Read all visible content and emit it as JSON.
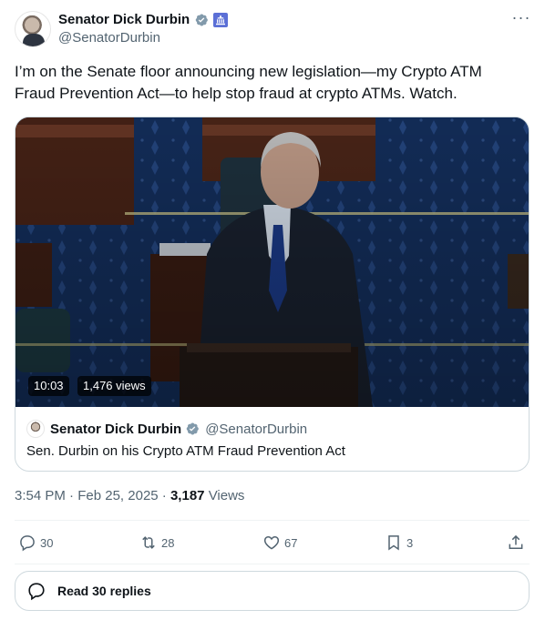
{
  "author": {
    "display_name": "Senator Dick Durbin",
    "handle": "@SenatorDurbin"
  },
  "tweet_text": "I’m on the Senate floor announcing new legislation—my Crypto ATM Fraud Prevention Act—to help stop fraud at crypto ATMs. Watch.",
  "video": {
    "duration": "10:03",
    "views": "1,476 views"
  },
  "quote": {
    "name": "Senator Dick Durbin",
    "handle": "@SenatorDurbin",
    "caption": "Sen. Durbin on his Crypto ATM Fraud Prevention Act"
  },
  "meta": {
    "time": "3:54 PM",
    "separator1": "·",
    "date": "Feb 25, 2025",
    "separator2": "·",
    "views_count": "3,187",
    "views_label": "Views"
  },
  "actions": {
    "replies": "30",
    "reposts": "28",
    "likes": "67",
    "bookmarks": "3"
  },
  "read_replies_label": "Read 30 replies",
  "colors": {
    "verified": "#829aab",
    "text_secondary": "#536471",
    "border": "#cfd9de"
  }
}
